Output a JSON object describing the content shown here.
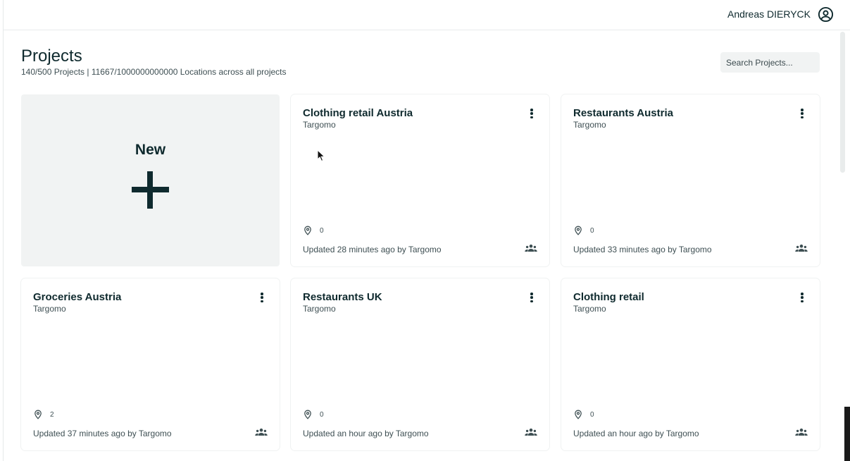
{
  "header": {
    "user_name": "Andreas DIERYCK",
    "user_icon": "account-circle-icon"
  },
  "page": {
    "title": "Projects",
    "subtitle": "140/500 Projects | 11667/1000000000000 Locations across all projects"
  },
  "search": {
    "placeholder": "Search Projects...",
    "value": ""
  },
  "new_card": {
    "label": "New",
    "icon": "plus-icon"
  },
  "projects": [
    {
      "title": "Clothing retail Austria",
      "owner": "Targomo",
      "locations": "0",
      "updated": "Updated 28 minutes ago by Targomo"
    },
    {
      "title": "Restaurants Austria",
      "owner": "Targomo",
      "locations": "0",
      "updated": "Updated 33 minutes ago by Targomo"
    },
    {
      "title": "Groceries Austria",
      "owner": "Targomo",
      "locations": "2",
      "updated": "Updated 37 minutes ago by Targomo"
    },
    {
      "title": "Restaurants UK",
      "owner": "Targomo",
      "locations": "0",
      "updated": "Updated an hour ago by Targomo"
    },
    {
      "title": "Clothing retail",
      "owner": "Targomo",
      "locations": "0",
      "updated": "Updated an hour ago by Targomo"
    }
  ],
  "colors": {
    "text_primary": "#0f2a2e",
    "text_secondary": "#3e4f53",
    "new_card_bg": "#f1f3f3",
    "search_bg": "#f1f3f3"
  }
}
